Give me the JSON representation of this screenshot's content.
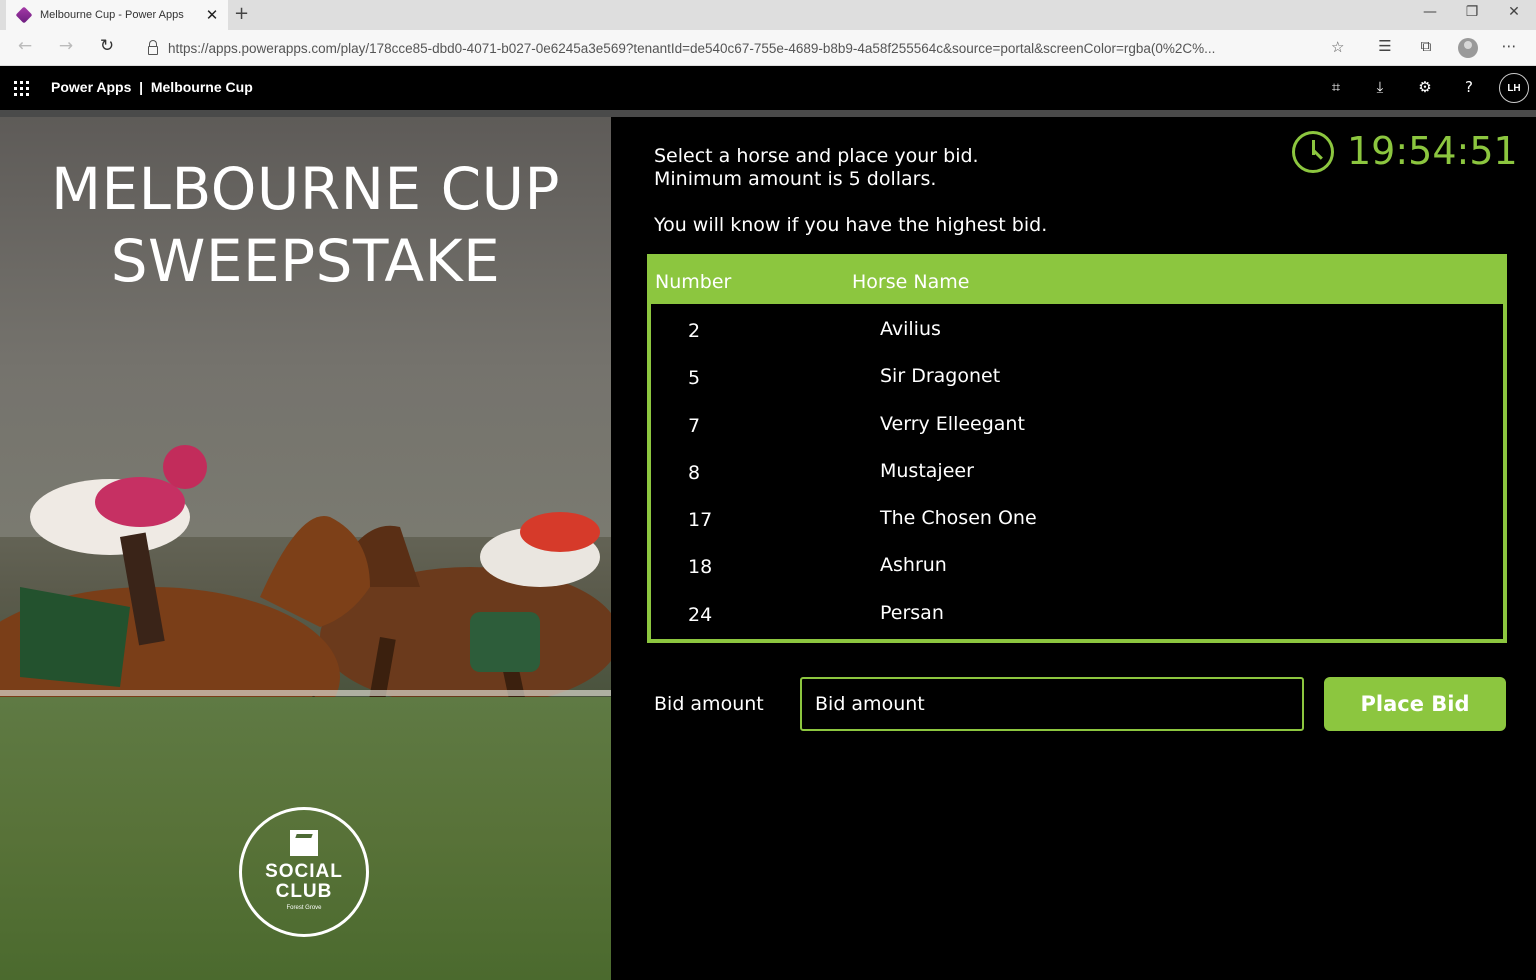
{
  "browser": {
    "tab_title": "Melbourne Cup - Power Apps",
    "tab_close": "✕",
    "new_tab": "+",
    "url": "https://apps.powerapps.com/play/178cce85-dbd0-4071-b027-0e6245a3e569?tenantId=de540c67-755e-4689-b8b9-4a58f255564c&source=portal&screenColor=rgba(0%2C%...",
    "icons": [
      "back-icon",
      "forward-icon",
      "refresh-icon",
      "lock-icon",
      "star-icon",
      "favorites-icon",
      "collections-icon",
      "profile-icon",
      "more-icon"
    ]
  },
  "app_header": {
    "title": "Power Apps  |  Melbourne Cup",
    "avatar_initials": "LH",
    "icons": [
      "waffle-icon",
      "fit-to-screen-icon",
      "download-icon",
      "settings-icon",
      "help-icon"
    ]
  },
  "hero": {
    "title_line1": "MELBOURNE CUP",
    "title_line2": "SWEEPSTAKE",
    "logo_line1": "SOCIAL",
    "logo_line2": "CLUB",
    "logo_line3": "Forest Grove"
  },
  "instructions": {
    "line1": "Select a horse and place your bid.",
    "line2": "Minimum amount is 5 dollars.",
    "line3": "You will know if you have the highest bid."
  },
  "clock": {
    "time": "19:54:51"
  },
  "table": {
    "headers": {
      "number": "Number",
      "horse_name": "Horse Name"
    },
    "rows": [
      {
        "number": "2",
        "name": "Avilius"
      },
      {
        "number": "5",
        "name": "Sir Dragonet"
      },
      {
        "number": "7",
        "name": "Verry Elleegant"
      },
      {
        "number": "8",
        "name": "Mustajeer"
      },
      {
        "number": "17",
        "name": "The Chosen One"
      },
      {
        "number": "18",
        "name": "Ashrun"
      },
      {
        "number": "24",
        "name": "Persan"
      }
    ]
  },
  "bid": {
    "label": "Bid amount",
    "placeholder": "Bid amount",
    "value": "",
    "button_label": "Place Bid"
  },
  "colors": {
    "accent": "#8cc63f",
    "background": "#000000",
    "header_divider": "#4a4a4a"
  }
}
